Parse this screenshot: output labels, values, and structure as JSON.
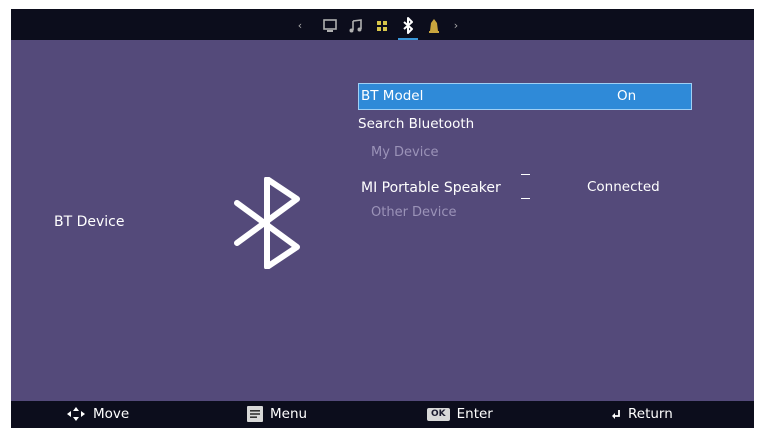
{
  "topbar": {
    "tabs": [
      {
        "name": "monitor-icon",
        "active": false
      },
      {
        "name": "music-icon",
        "active": false
      },
      {
        "name": "grid-icon",
        "active": false
      },
      {
        "name": "bluetooth-icon",
        "active": true
      },
      {
        "name": "bell-icon",
        "active": false
      }
    ],
    "arrow_left_icon": "chevron-left-icon",
    "arrow_right_icon": "chevron-right-icon"
  },
  "side": {
    "title": "BT Device",
    "logo_icon": "bluetooth-logo-icon"
  },
  "menu": {
    "bt_model_label": "BT Model",
    "bt_model_value": "On",
    "search_label": "Search Bluetooth",
    "my_device_title": "My Device",
    "my_devices": [
      {
        "name": "MI Portable Speaker",
        "status": "Connected"
      }
    ],
    "other_device_title": "Other Device"
  },
  "footer": {
    "move": "Move",
    "menu": "Menu",
    "ok_key": "OK",
    "enter": "Enter",
    "return": "Return"
  },
  "colors": {
    "background": "#544a7a",
    "bar": "#0c0d1c",
    "highlight": "#2f8ad8",
    "dim_text": "#9b93b8"
  }
}
